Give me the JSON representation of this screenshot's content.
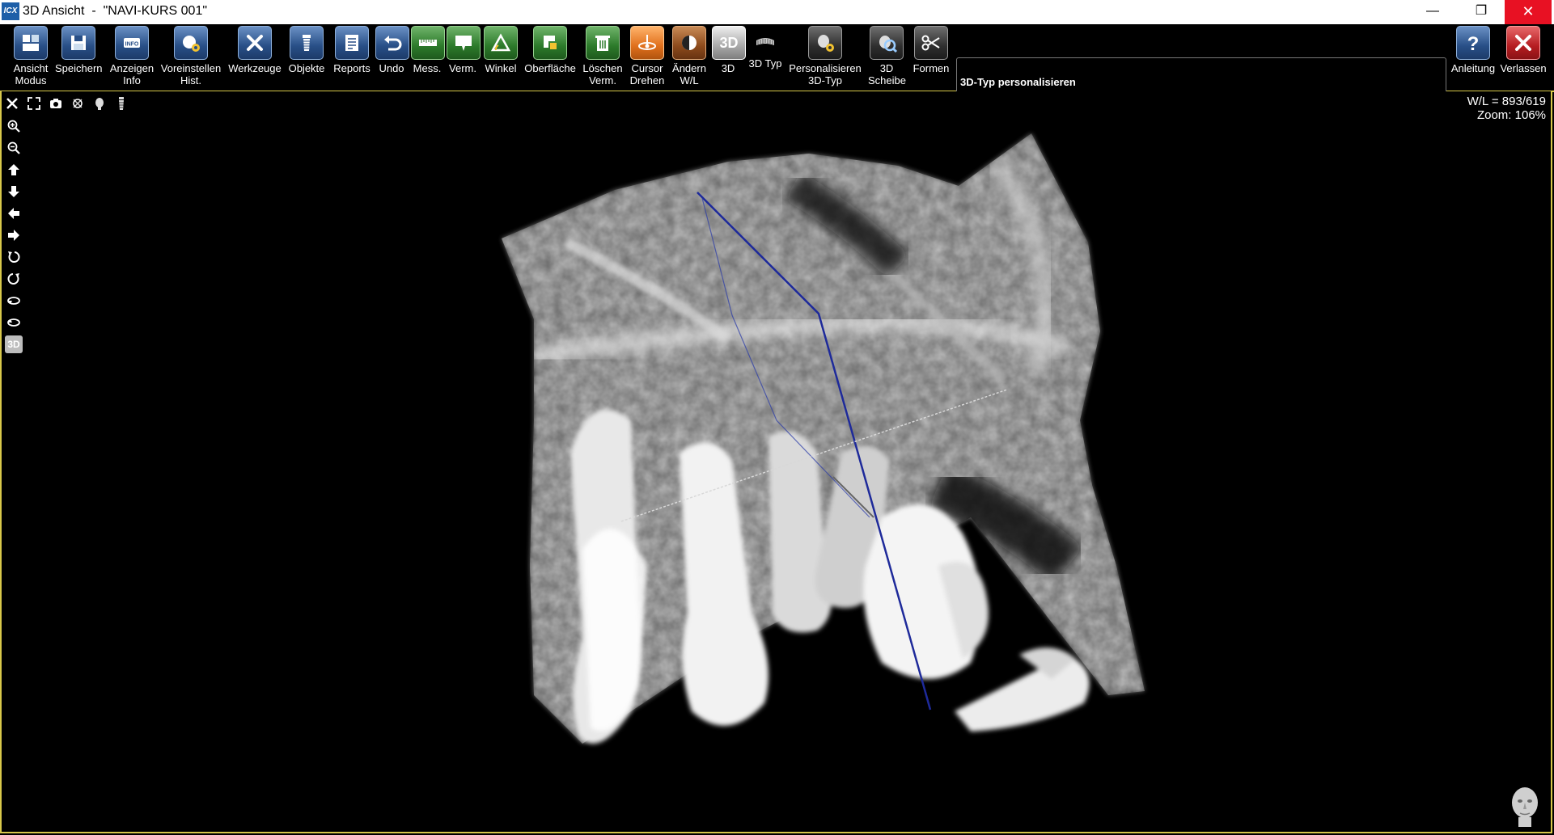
{
  "window": {
    "app_icon_text": "ICX",
    "title": "3D Ansicht  -  \"NAVI-KURS 001\"",
    "minimize_glyph": "—",
    "restore_glyph": "❐",
    "close_glyph": "✕"
  },
  "toolbar": {
    "items": [
      {
        "line1": "Ansicht",
        "line2": "Modus",
        "icon": "view-mode-icon",
        "color": "#284f87"
      },
      {
        "line1": "Speichern",
        "line2": "",
        "icon": "save-icon",
        "color": "#284f87"
      },
      {
        "line1": "Anzeigen",
        "line2": "Info",
        "icon": "info-icon",
        "color": "#284f87"
      },
      {
        "line1": "Voreinstellen",
        "line2": "Hist.",
        "icon": "histogram-settings-icon",
        "color": "#284f87"
      },
      {
        "line1": "Werkzeuge",
        "line2": "",
        "icon": "tools-icon",
        "color": "#284f87"
      },
      {
        "line1": "Objekte",
        "line2": "",
        "icon": "implant-icon",
        "color": "#284f87"
      },
      {
        "line1": "Reports",
        "line2": "",
        "icon": "report-icon",
        "color": "#284f87"
      },
      {
        "line1": "Undo",
        "line2": "",
        "icon": "undo-icon",
        "color": "#284f87"
      },
      {
        "line1": "Mess.",
        "line2": "",
        "icon": "measure-icon",
        "color": "#2c7a2a"
      },
      {
        "line1": "Verm.",
        "line2": "",
        "icon": "annotation-icon",
        "color": "#2c7a2a"
      },
      {
        "line1": "Winkel",
        "line2": "",
        "icon": "angle-icon",
        "color": "#2c7a2a"
      },
      {
        "line1": "Oberfläche",
        "line2": "",
        "icon": "surface-icon",
        "color": "#2c7a2a"
      },
      {
        "line1": "Löschen",
        "line2": "Verm.",
        "icon": "trash-icon",
        "color": "#2c7a2a"
      },
      {
        "line1": "Cursor",
        "line2": "Drehen",
        "icon": "rotate-cursor-icon",
        "color": "#e0701c"
      },
      {
        "line1": "Ändern",
        "line2": "W/L",
        "icon": "window-level-icon",
        "color": "#8d4b1c"
      },
      {
        "line1": "3D",
        "line2": "",
        "icon": "3d-icon",
        "color": "#a9a9a9",
        "glyph": "3D"
      },
      {
        "line1": "3D Typ",
        "line2": "",
        "icon": "3d-type-icon",
        "color": "#2f2f2f"
      },
      {
        "line1": "Personalisieren",
        "line2": "3D-Typ",
        "icon": "personalize-3d-icon",
        "color": "#2f2f2f"
      },
      {
        "line1": "3D",
        "line2": "Scheibe",
        "icon": "3d-slice-icon",
        "color": "#2f2f2f"
      },
      {
        "line1": "Formen",
        "line2": "",
        "icon": "scissors-icon",
        "color": "#2f2f2f"
      }
    ],
    "message": "3D-Typ personalisieren",
    "right_items": [
      {
        "line1": "Anleitung",
        "icon": "help-icon"
      },
      {
        "line1": "Verlassen",
        "icon": "exit-icon"
      }
    ]
  },
  "viewport": {
    "wl_text": "W/L = 893/619",
    "zoom_text": "Zoom: 106%",
    "side_tools": [
      "zoom-in-icon",
      "zoom-out-icon",
      "arrow-up-icon",
      "arrow-down-icon",
      "arrow-left-icon",
      "arrow-right-icon",
      "rotate-ccw-icon",
      "rotate-cw-icon",
      "tilt-left-icon",
      "tilt-right-icon",
      "3d-reset-icon"
    ],
    "side_3d_glyph": "3D",
    "top_tools": [
      "tools-small-icon",
      "fullscreen-icon",
      "camera-icon",
      "rotate-view-icon",
      "head-view-icon",
      "implant-small-icon"
    ]
  }
}
